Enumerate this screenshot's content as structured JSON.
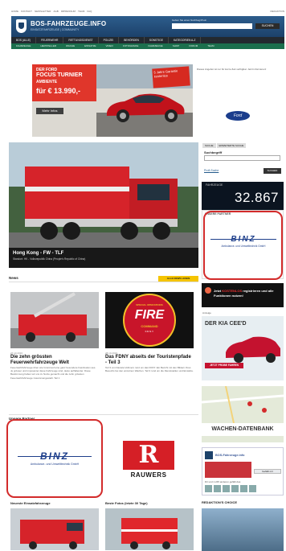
{
  "toplinks": [
    "HOME",
    "KONTAKT",
    "NEWSLETTER",
    "AGB",
    "IMPRESSUM",
    "TEAM",
    "FAQ",
    "REDAKTION"
  ],
  "header": {
    "title": "BOS-FAHRZEUGE.INFO",
    "subtitle": "EINSATZFAHRZEUGE | COMMUNITY",
    "search_label": "Geben Sie einen Suchbegriff ein",
    "search_button": "SUCHEN"
  },
  "nav_primary": [
    "BOS (ALLE)",
    "FEUERWEHR",
    "RETTUNGSDIENST",
    "POLIZEI",
    "BEHÖRDEN",
    "SONSTIGE",
    "KATEGORIEN A-Z"
  ],
  "nav_secondary": [
    "FAHRZEUGE",
    "HERSTELLER",
    "WACHE",
    "EINSATZE",
    "VIDEO",
    "FOTOGRAFIE",
    "FAHRZEUGE",
    "SHOP",
    "FORUM",
    "TEAM"
  ],
  "ad": {
    "line1": "DER FORD",
    "line2": "FOCUS TURNIER",
    "line3": "AMBIENTE",
    "price": "für € 13.990,-",
    "more_button": "Mehr Infos",
    "stamp": "5 Jahre Garantie kostenlos",
    "brand": "Ford",
    "side_text": "Dieses Angebot ist nur für kurze Zeit verfügbar. Jetzt informieren!",
    "colors": {
      "badge": "#e0362b",
      "car": "#c1121b"
    }
  },
  "hero": {
    "title": "Hong Kong - FW - TLF",
    "subtitle": "Standort: HK - Volksrepublik China (People's Republic of China)"
  },
  "sidebar": {
    "tabs": [
      "SUCHE",
      "ERWEITERTE SUCHE"
    ],
    "search_label": "Suchbegriff",
    "more_link": "Profi-Suche",
    "search_button": "SUCHEN",
    "counter_label": "FAHRZEUGE",
    "counter_value": "32.867",
    "partner_header": "UNSERE PARTNER",
    "binz_logo": "BINZ",
    "binz_sub": "Ambulance- und Umwelttechnik GmbH",
    "promo_text1": "Jetzt",
    "promo_highlight": "KOSTENLOS",
    "promo_text2": "registrieren und alle Funktionen nutzen!",
    "kia_label": "Anzeige",
    "kia_title": "DER KIA CEE'D",
    "kia_button": "JETZT PROBE FAHREN",
    "map_title": "WACHEN-DATENBANK",
    "fb_name": "BOS-Fahrzeuge.info",
    "fb_button": "Gefällt mir",
    "fb_like_text": "Dir und 1.245 anderen gefällt das",
    "choice_header": "REDAKTION'S CHOICE"
  },
  "news": {
    "header": "News",
    "all_button": "ALLE NEWS LESEN",
    "items": [
      {
        "date": "27.10.2016",
        "title": "Die zehn grössten Feuerwehrfahrzeuge Welt",
        "body": "Feuerwehrfahrzeuge üben wie Grund auf eine ganz besondere Faszination aus. Je grösser und imposanter diese Fahrzeuge sind, desto auffallender. Diese Bestimmung haben wir uns zu Nutze gemacht und die zehn grössten Feuerwehrfahrzeuge zusammengestellt. Teil 1"
      },
      {
        "date": "28.10.2016",
        "title": "Das FDNY abseits der Touristenpfade - Teil 3",
        "body": "Teil 3 von Daniela Vollmers rund um das FDNY. Ein Bericht mit den Bildern ihres Besuchs bei den einzelnen Wachen. Teil 3 rund um die Dienststellen und Einsätze."
      }
    ],
    "fire_badge": {
      "line1": "SPECIAL OPERATIONS",
      "line2": "FIRE",
      "line3": "COMMAND",
      "line4": "F.D.N.Y."
    }
  },
  "partners": {
    "header": "Unsere Partner",
    "binz_logo": "BINZ",
    "binz_sub": "Ambulance- und Umwelttechnik GmbH",
    "rauwers_mark": "R",
    "rauwers_name": "RAUWERS"
  },
  "bottom": {
    "left_header": "Neueste Einsatzfahrzeuge",
    "right_header": "Beste Fotos (letzte 30 Tage)"
  },
  "colors": {
    "header": "#1c416a",
    "nav_green": "#1b6f4d",
    "accent_yellow": "#f5c400",
    "highlight_red": "#d32b2b"
  }
}
